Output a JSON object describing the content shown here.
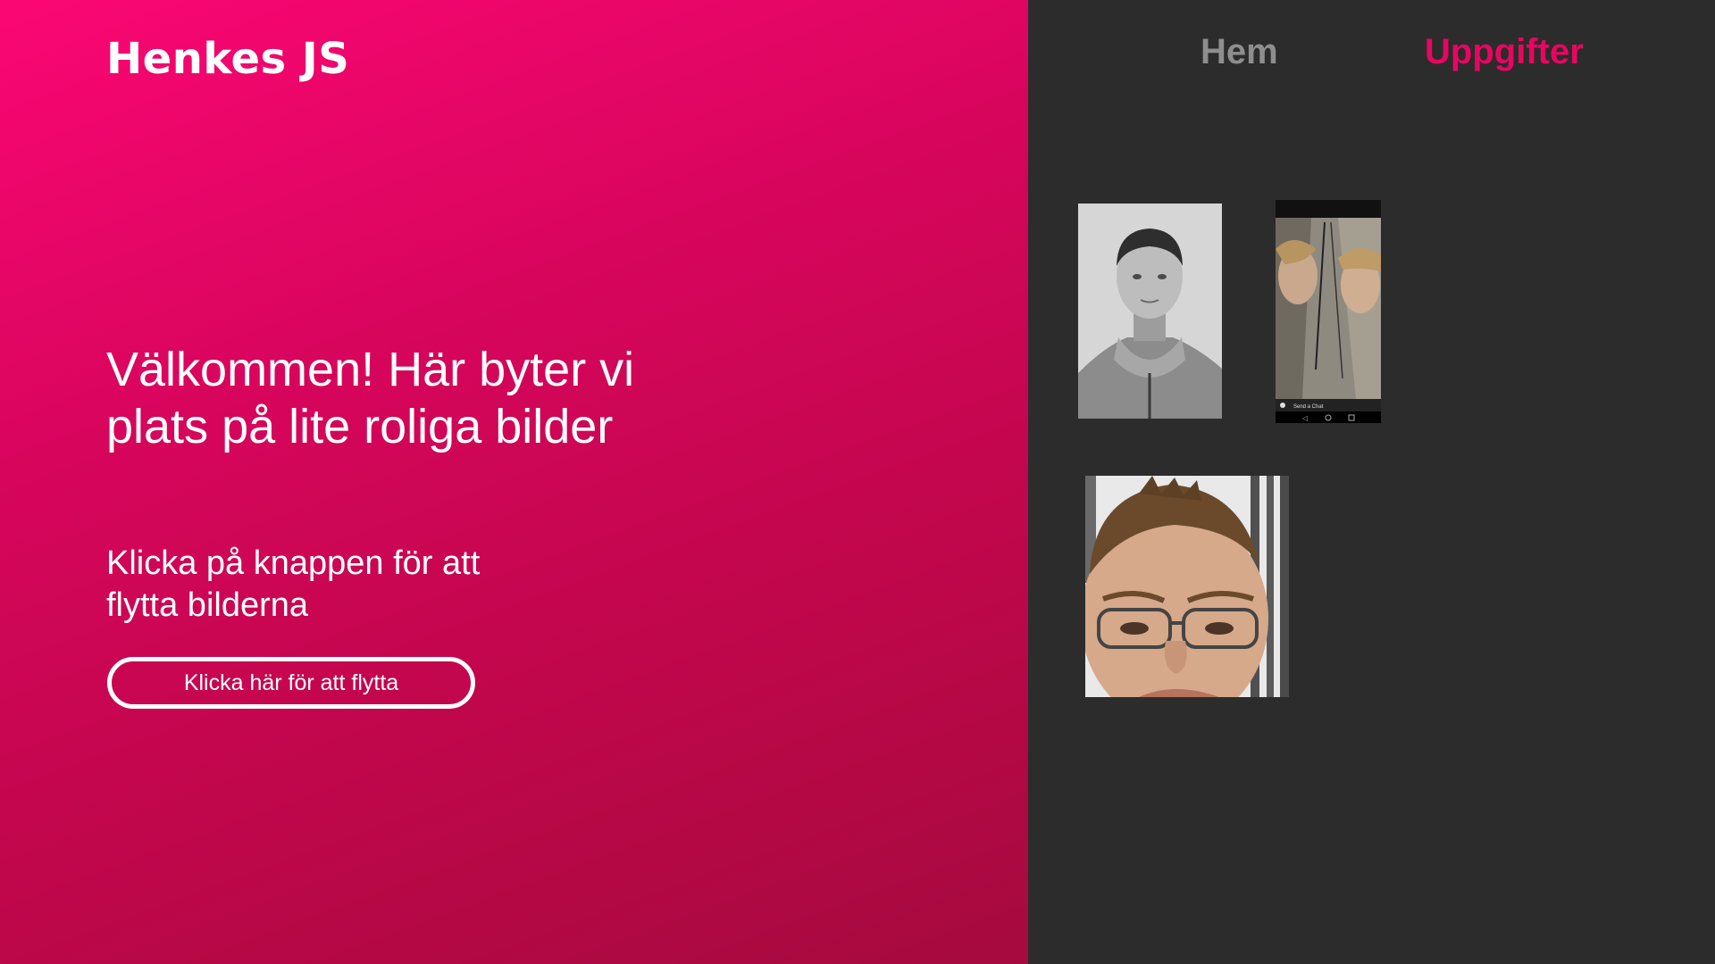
{
  "header": {
    "brand": "Henkes JS",
    "nav": [
      {
        "label": "Hem",
        "active": false
      },
      {
        "label": "Uppgifter",
        "active": true
      }
    ]
  },
  "hero": {
    "headline": "Välkommen! Här byter vi plats på lite roliga bilder",
    "subline": "Klicka på knappen för att flytta bilderna",
    "button_label": "Klicka här för att flytta"
  },
  "photos": [
    {
      "name": "portrait-man-gray-hoodie"
    },
    {
      "name": "phone-screenshot-mirror-selfie",
      "caption": "Send a Chat"
    },
    {
      "name": "closeup-face-glasses"
    }
  ],
  "colors": {
    "gradient_start": "#fb0774",
    "gradient_end": "#a50a3e",
    "panel": "#2c2c2c",
    "nav_active": "#e8065f",
    "nav_inactive": "#8e8e8e"
  }
}
